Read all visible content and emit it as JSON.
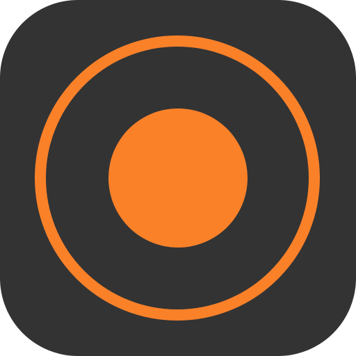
{
  "app_icon": {
    "name": "record-button-icon",
    "background_color": "#333333",
    "accent_color": "#FB8129"
  }
}
